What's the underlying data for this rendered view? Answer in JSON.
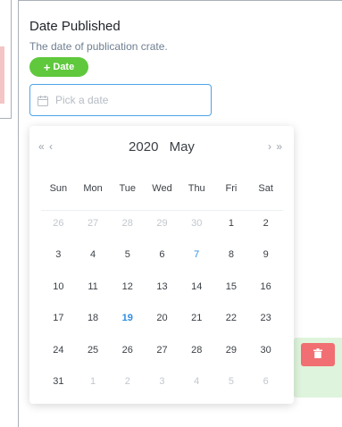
{
  "field": {
    "title": "Date Published",
    "description": "The date of publication crate.",
    "add_button_label": "Date",
    "input_placeholder": "Pick a date"
  },
  "picker": {
    "prev_nav": "« ‹",
    "next_nav": "› »",
    "year": "2020",
    "month": "May",
    "weekdays": [
      "Sun",
      "Mon",
      "Tue",
      "Wed",
      "Thu",
      "Fri",
      "Sat"
    ],
    "days": [
      {
        "d": "26",
        "muted": true
      },
      {
        "d": "27",
        "muted": true
      },
      {
        "d": "28",
        "muted": true
      },
      {
        "d": "29",
        "muted": true
      },
      {
        "d": "30",
        "muted": true
      },
      {
        "d": "1"
      },
      {
        "d": "2"
      },
      {
        "d": "3"
      },
      {
        "d": "4"
      },
      {
        "d": "5"
      },
      {
        "d": "6"
      },
      {
        "d": "7",
        "marked": true
      },
      {
        "d": "8"
      },
      {
        "d": "9"
      },
      {
        "d": "10"
      },
      {
        "d": "11"
      },
      {
        "d": "12"
      },
      {
        "d": "13"
      },
      {
        "d": "14"
      },
      {
        "d": "15"
      },
      {
        "d": "16"
      },
      {
        "d": "17"
      },
      {
        "d": "18"
      },
      {
        "d": "19",
        "today": true
      },
      {
        "d": "20"
      },
      {
        "d": "21"
      },
      {
        "d": "22"
      },
      {
        "d": "23"
      },
      {
        "d": "24"
      },
      {
        "d": "25"
      },
      {
        "d": "26"
      },
      {
        "d": "27"
      },
      {
        "d": "28"
      },
      {
        "d": "29"
      },
      {
        "d": "30"
      },
      {
        "d": "31"
      },
      {
        "d": "1",
        "muted": true
      },
      {
        "d": "2",
        "muted": true
      },
      {
        "d": "3",
        "muted": true
      },
      {
        "d": "4",
        "muted": true
      },
      {
        "d": "5",
        "muted": true
      },
      {
        "d": "6",
        "muted": true
      }
    ]
  },
  "icons": {
    "calendar": "calendar-icon",
    "delete": "trash-icon",
    "add": "plus-icon"
  },
  "colors": {
    "accent_green": "#5fc83c",
    "accent_blue": "#2f8de4",
    "danger": "#f16f72"
  }
}
